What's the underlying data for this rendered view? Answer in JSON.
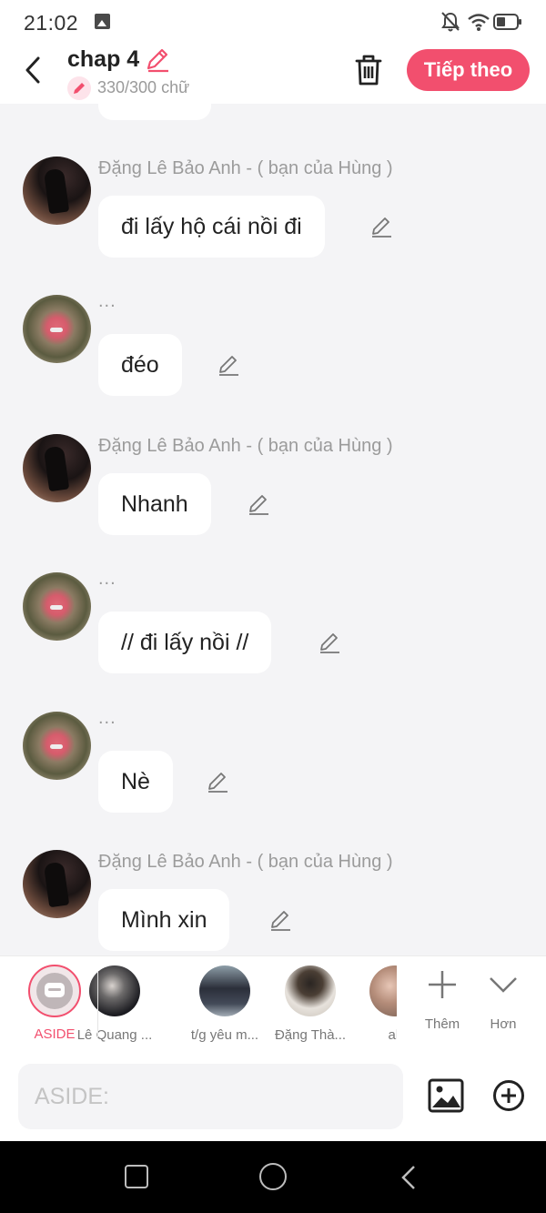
{
  "status_bar": {
    "time": "21:02"
  },
  "header": {
    "title": "chap 4",
    "word_count": "330/300 chữ",
    "next_button": "Tiếp theo"
  },
  "messages": [
    {
      "sender": "Đặng Lê Bảo Anh - ( bạn của Hùng )",
      "text": "đi lấy hộ cái nồi đi",
      "avatar": "girl-in-black"
    },
    {
      "sender": "...",
      "text": "đéo",
      "avatar": "pig"
    },
    {
      "sender": "Đặng Lê Bảo Anh - ( bạn của Hùng )",
      "text": "Nhanh",
      "avatar": "girl-in-black"
    },
    {
      "sender": "...",
      "text": "// đi lấy nồi //",
      "avatar": "pig"
    },
    {
      "sender": "...",
      "text": "Nè",
      "avatar": "pig"
    },
    {
      "sender": "Đặng Lê Bảo Anh - ( bạn của Hùng )",
      "text": "Mình xin",
      "avatar": "girl-in-black"
    }
  ],
  "character_bar": {
    "aside_label": "ASIDE",
    "characters": [
      {
        "name": "Lê Quang ..."
      },
      {
        "name": "t/g yêu m..."
      },
      {
        "name": "Đặng Thà..."
      },
      {
        "name": "all"
      }
    ],
    "more_label": "Thêm",
    "expand_label": "Hơn"
  },
  "input": {
    "placeholder": "ASIDE:"
  },
  "colors": {
    "accent": "#f24f6e",
    "background": "#f4f4f6",
    "bubble": "#ffffff"
  }
}
